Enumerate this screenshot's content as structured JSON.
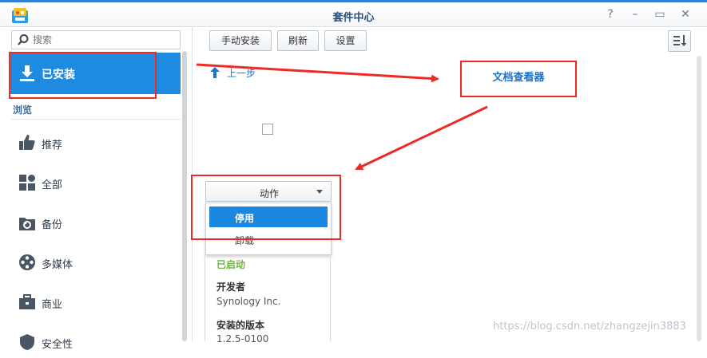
{
  "window": {
    "title": "套件中心",
    "controls": [
      "?",
      "–",
      "▭",
      "✕"
    ]
  },
  "sidebar": {
    "search_placeholder": "搜索",
    "installed_label": "已安装",
    "section_label": "浏览",
    "items": [
      {
        "label": "推荐",
        "icon": "thumbs-up-icon"
      },
      {
        "label": "全部",
        "icon": "grid-icon"
      },
      {
        "label": "备份",
        "icon": "backup-icon"
      },
      {
        "label": "多媒体",
        "icon": "film-reel-icon"
      },
      {
        "label": "商业",
        "icon": "briefcase-icon"
      },
      {
        "label": "安全性",
        "icon": "shield-icon"
      }
    ]
  },
  "toolbar": {
    "manual_install": "手动安装",
    "refresh": "刷新",
    "settings": "设置"
  },
  "main": {
    "back_label": "上一步",
    "package_name": "文档查看器",
    "action_label": "动作",
    "menu": [
      "停用",
      "卸载"
    ],
    "status": "已启动",
    "developer_label": "开发者",
    "developer_value": "Synology Inc.",
    "version_label": "安装的版本",
    "version_value": "1.2.5-0100"
  },
  "watermark": "https://blog.csdn.net/zhangzejin3883",
  "colors": {
    "accent": "#1d8be0",
    "status_green": "#6db33f",
    "annotation_red": "#ee2a24"
  }
}
